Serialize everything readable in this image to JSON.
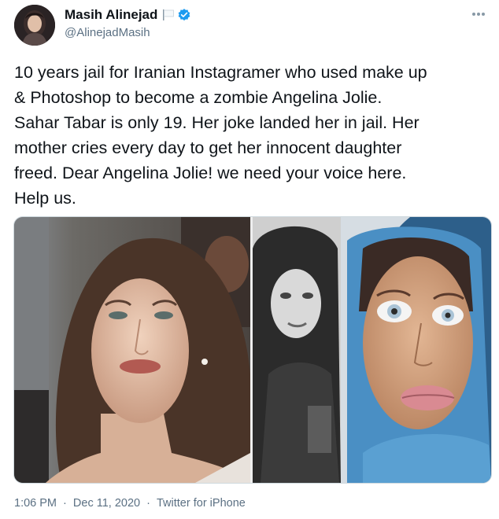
{
  "user": {
    "display_name": "Masih Alinejad",
    "handle": "@AlinejadMasih",
    "verified": true,
    "avatar_icon": "avatar-photo",
    "flag_icon": "white-flag-icon",
    "verified_icon": "verified-badge-icon",
    "accent_color": "#1d9bf0"
  },
  "tweet": {
    "text": "10 years jail for Iranian Instagramer who used make up\n& Photoshop to become a zombie Angelina Jolie.\nSahar Tabar is only 19. Her joke landed her in jail. Her\nmother cries every day to get her innocent daughter\nfreed. Dear Angelina Jolie!  we need your voice here.\nHelp us."
  },
  "media": {
    "images": [
      {
        "name": "left-photo"
      },
      {
        "name": "right-collage-photo"
      }
    ]
  },
  "meta": {
    "time": "1:06 PM",
    "separator": "·",
    "date": "Dec 11, 2020",
    "source": "Twitter for iPhone"
  }
}
